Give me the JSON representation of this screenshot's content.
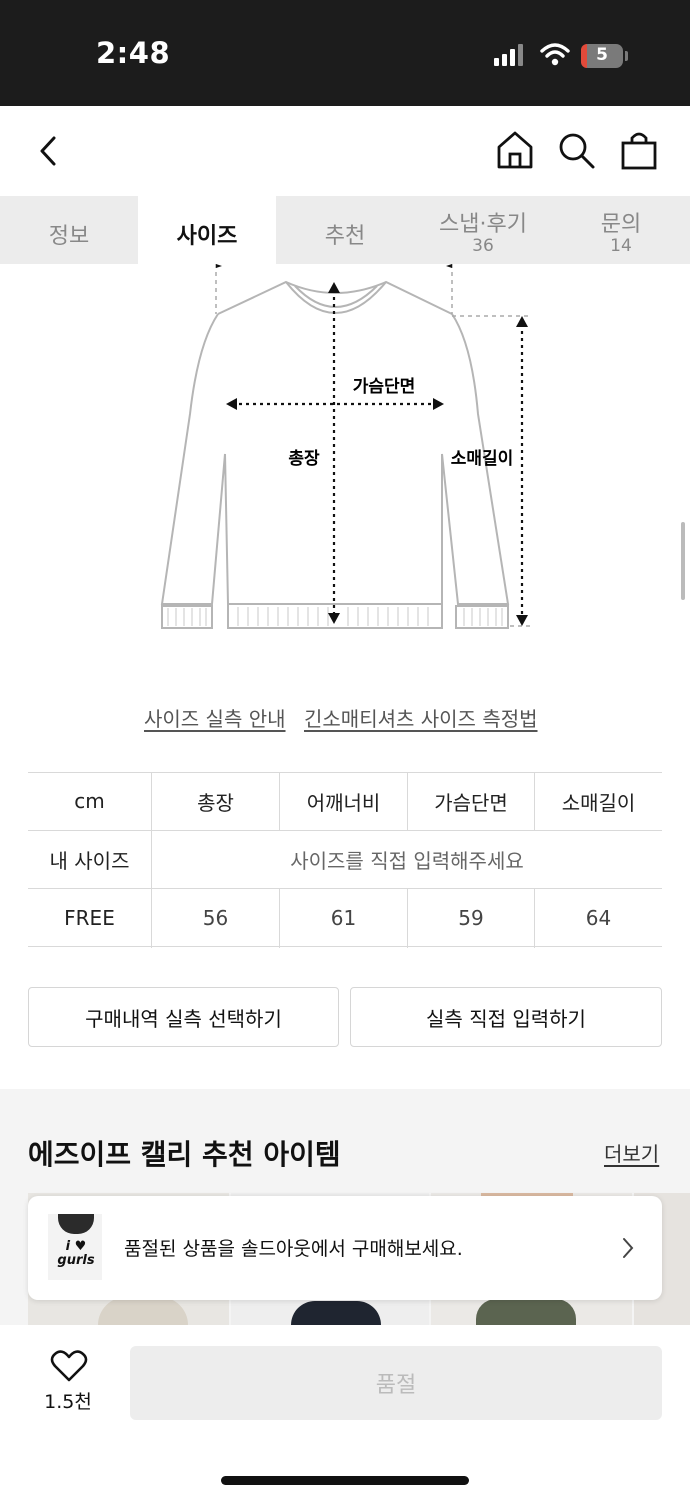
{
  "status_bar": {
    "time": "2:48",
    "battery": "5"
  },
  "tabs": [
    {
      "label": "정보",
      "count": ""
    },
    {
      "label": "사이즈",
      "count": ""
    },
    {
      "label": "추천",
      "count": ""
    },
    {
      "label": "스냅·후기",
      "count": "36"
    },
    {
      "label": "문의",
      "count": "14"
    }
  ],
  "diagram": {
    "chest": "가슴단면",
    "length": "총장",
    "sleeve": "소매길이"
  },
  "links": {
    "guide": "사이즈 실측 안내",
    "howto": "긴소매티셔츠 사이즈 측정법"
  },
  "size_table": {
    "headers": [
      "cm",
      "총장",
      "어깨너비",
      "가슴단면",
      "소매길이"
    ],
    "my_size_label": "내 사이즈",
    "my_size_placeholder": "사이즈를 직접 입력해주세요",
    "rows": [
      {
        "size": "FREE",
        "values": [
          "56",
          "61",
          "59",
          "64"
        ]
      }
    ]
  },
  "buttons": {
    "select_history": "구매내역 실측 선택하기",
    "direct_input": "실측 직접 입력하기"
  },
  "recommend": {
    "title": "에즈이프 캘리 추천 아이템",
    "more": "더보기"
  },
  "toast": {
    "text": "품절된 상품을 솔드아웃에서 구매해보세요.",
    "thumb_text": "i ♥ gurls"
  },
  "bottom_bar": {
    "likes": "1.5천",
    "buy_label": "품절"
  }
}
